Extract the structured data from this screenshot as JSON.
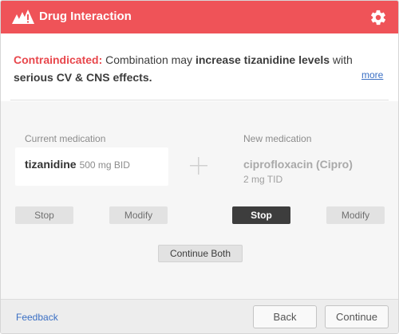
{
  "header": {
    "title": "Drug Interaction",
    "settings_icon": "gear-icon",
    "logo_icon": "alert-triangles-icon"
  },
  "warning": {
    "label": "Contraindicated:",
    "text_1": " Combination may ",
    "bold_1": "increase tizanidine levels",
    "text_2": " with ",
    "bold_2": "serious CV & CNS effects.",
    "more_link": "more"
  },
  "current": {
    "label": "Current medication",
    "name": "tizanidine",
    "dose": "500 mg BID",
    "stop_label": "Stop",
    "modify_label": "Modify"
  },
  "new_med": {
    "label": "New medication",
    "name": "ciprofloxacin (Cipro)",
    "dose": "2 mg TID",
    "stop_label": "Stop",
    "modify_label": "Modify"
  },
  "continue_both_label": "Continue Both",
  "footer": {
    "feedback_link": "Feedback",
    "back_label": "Back",
    "continue_label": "Continue"
  },
  "colors": {
    "header_red": "#ef5358",
    "contraindicated_red": "#e8474c",
    "link_blue": "#3a6fc4",
    "dark_button": "#3d3d3d"
  }
}
